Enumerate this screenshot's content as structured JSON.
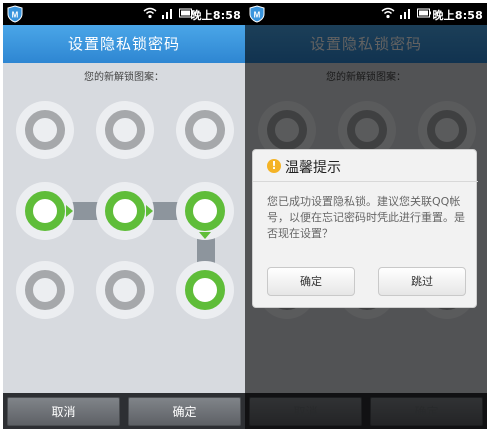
{
  "status_bar": {
    "time": "晚上8:58"
  },
  "lock_screen": {
    "title": "设置隐私锁密码",
    "subtitle": "您的新解锁图案：",
    "pattern": {
      "grid": 3,
      "selected_sequence": [
        4,
        5,
        6,
        9
      ]
    },
    "buttons": {
      "cancel": "取消",
      "confirm": "确定"
    }
  },
  "dialog": {
    "title": "温馨提示",
    "message": "您已成功设置隐私锁。建议您关联QQ帐号，以便在忘记密码时凭此进行重置。是否现在设置？",
    "buttons": {
      "confirm": "确定",
      "skip": "跳过"
    }
  },
  "colors": {
    "title_bar": "#3a95dd",
    "pattern_active": "#5fbd39",
    "pattern_inactive": "#a6a8ab",
    "warning_icon": "#f4b326"
  }
}
